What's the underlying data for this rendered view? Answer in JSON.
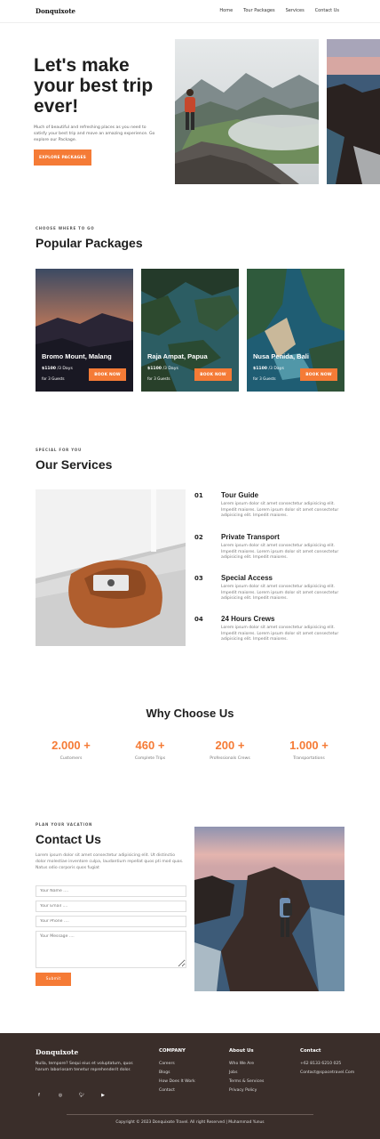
{
  "nav": {
    "brand": "Donquixote",
    "links": [
      "Home",
      "Tour Packages",
      "Services",
      "Contact Us"
    ]
  },
  "hero": {
    "title": "Let's make your best trip ever!",
    "subtitle": "Much of beautiful and refreshing places as you need to satisfy your best trip and move an amazing experience. Go explore our Package.",
    "cta": "EXPLORE PACKAGES"
  },
  "packages": {
    "eyebrow": "CHOOSE WHERE TO GO",
    "title": "Popular Packages",
    "items": [
      {
        "name": "Bromo Mount, Malang",
        "price": "$1100",
        "duration": "/3 Days",
        "guests": "for 3 Guests",
        "cta": "BOOK NOW"
      },
      {
        "name": "Raja Ampat, Papua",
        "price": "$1100",
        "duration": "/3 Days",
        "guests": "for 3 Guests",
        "cta": "BOOK NOW"
      },
      {
        "name": "Nusa Penida, Bali",
        "price": "$1100",
        "duration": "/3 Days",
        "guests": "for 3 Guests",
        "cta": "BOOK NOW"
      }
    ]
  },
  "services": {
    "eyebrow": "SPECIAL FOR YOU",
    "title": "Our Services",
    "items": [
      {
        "num": "01",
        "title": "Tour Guide",
        "desc": "Lorem ipsum dolor sit amet consectetur adipisicing elit. Impedit maiores. Lorem ipsum dolor sit amet consectetur adipisicing elit. Impedit maiores."
      },
      {
        "num": "02",
        "title": "Private Transport",
        "desc": "Lorem ipsum dolor sit amet consectetur adipisicing elit. Impedit maiores. Lorem ipsum dolor sit amet consectetur adipisicing elit. Impedit maiores."
      },
      {
        "num": "03",
        "title": "Special Access",
        "desc": "Lorem ipsum dolor sit amet consectetur adipisicing elit. Impedit maiores. Lorem ipsum dolor sit amet consectetur adipisicing elit. Impedit maiores."
      },
      {
        "num": "04",
        "title": "24 Hours Crews",
        "desc": "Lorem ipsum dolor sit amet consectetur adipisicing elit. Impedit maiores. Lorem ipsum dolor sit amet consectetur adipisicing elit. Impedit maiores."
      }
    ]
  },
  "why": {
    "title": "Why Choose Us",
    "stats": [
      {
        "value": "2.000 +",
        "label": "Customers"
      },
      {
        "value": "460 +",
        "label": "Complete Trips"
      },
      {
        "value": "200 +",
        "label": "Professionals Crews"
      },
      {
        "value": "1.000 +",
        "label": "Transportations"
      }
    ]
  },
  "contact": {
    "eyebrow": "PLAN YOUR VACATION",
    "title": "Contact Us",
    "desc": "Lorem ipsum dolor sit amet consectetur adipisicing elit. Ut distinctio dolor molestiae inventore culpa, laudantium repellat quos pti mod quas. Natus odio corporis quos fugiat",
    "name_placeholder": "Your Name ....",
    "email_placeholder": "Your Email ....",
    "phone_placeholder": "Your Phone ....",
    "message_placeholder": "Your Message ....",
    "submit": "Submit"
  },
  "footer": {
    "brand": "Donquixote",
    "desc": "Nulla, tempore? Sequi eius et voluptatum, quos harum laboriosam tenetur reprehenderit dolor.",
    "social": [
      "facebook-icon",
      "instagram-icon",
      "twitter-icon",
      "youtube-icon"
    ],
    "company": {
      "title": "COMPANY",
      "links": [
        "Careers",
        "Blogs",
        "How Does It Work",
        "Contact"
      ]
    },
    "about": {
      "title": "About Us",
      "links": [
        "Who We Are",
        "Jobs",
        "Terms & Services",
        "Privacy Policy"
      ]
    },
    "contact": {
      "title": "Contact",
      "links": [
        "+62 8133 6210 025",
        "Contact@spacetravel.Com"
      ]
    },
    "copyright": "Copyright © 2023 Donquixote Travel. All right Reserved | Muhammad Yunus"
  },
  "colors": {
    "accent": "#f57b36",
    "footer_bg": "#3a2e2a"
  }
}
